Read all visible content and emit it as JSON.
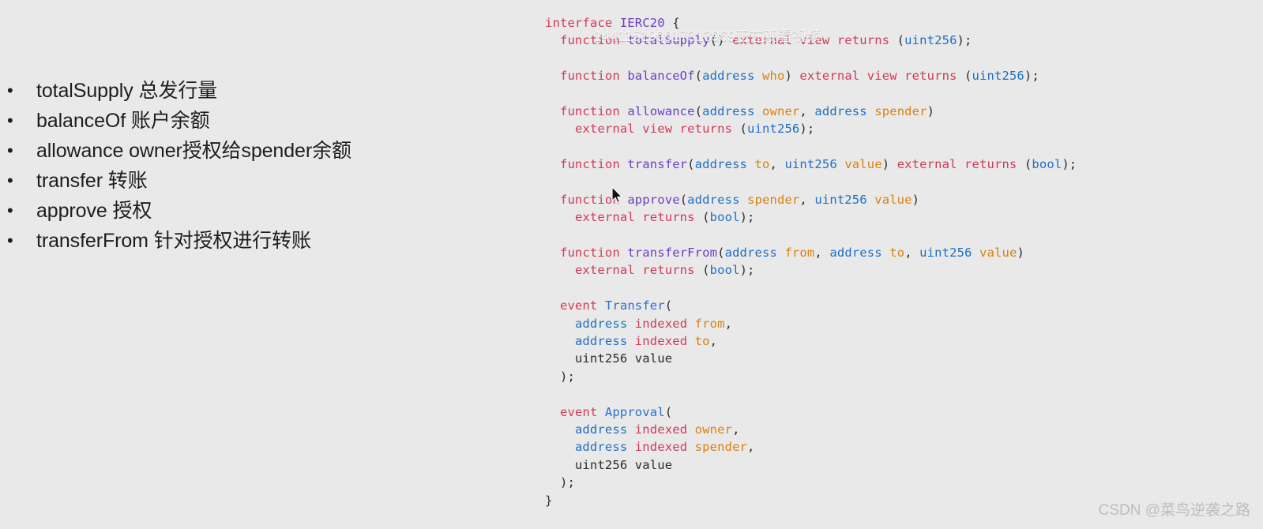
{
  "slide": {
    "background_color": "#e9e9e9",
    "bullet_glyph": "•"
  },
  "bullets": [
    {
      "text": "totalSupply 总发行量"
    },
    {
      "text": "balanceOf  账户余额"
    },
    {
      "text": "allowance owner授权给spender余额"
    },
    {
      "text": "transfer  转账"
    },
    {
      "text": "approve 授权"
    },
    {
      "text": "transferFrom 针对授权进行转账"
    }
  ],
  "code": {
    "language": "solidity",
    "colors": {
      "keyword": "#cf3a5a",
      "function_name": "#6b3fbf",
      "type": "#1f6fc4",
      "parameter": "#d9820f",
      "event_name": "#2a6fd0",
      "plain": "#2b2b2b"
    },
    "lines": [
      [
        {
          "t": "interface",
          "c": "kw"
        },
        {
          "t": " ",
          "c": "plain"
        },
        {
          "t": "IERC20",
          "c": "fn"
        },
        {
          "t": " {",
          "c": "plain"
        }
      ],
      [
        {
          "t": "  ",
          "c": "plain"
        },
        {
          "t": "function",
          "c": "kw"
        },
        {
          "t": " ",
          "c": "plain"
        },
        {
          "t": "totalSupply",
          "c": "fn"
        },
        {
          "t": "() ",
          "c": "plain"
        },
        {
          "t": "external view returns",
          "c": "kw"
        },
        {
          "t": " (",
          "c": "plain"
        },
        {
          "t": "uint256",
          "c": "type"
        },
        {
          "t": ");",
          "c": "plain"
        }
      ],
      [],
      [
        {
          "t": "  ",
          "c": "plain"
        },
        {
          "t": "function",
          "c": "kw"
        },
        {
          "t": " ",
          "c": "plain"
        },
        {
          "t": "balanceOf",
          "c": "fn"
        },
        {
          "t": "(",
          "c": "plain"
        },
        {
          "t": "address",
          "c": "type"
        },
        {
          "t": " ",
          "c": "plain"
        },
        {
          "t": "who",
          "c": "param"
        },
        {
          "t": ") ",
          "c": "plain"
        },
        {
          "t": "external view returns",
          "c": "kw"
        },
        {
          "t": " (",
          "c": "plain"
        },
        {
          "t": "uint256",
          "c": "type"
        },
        {
          "t": ");",
          "c": "plain"
        }
      ],
      [],
      [
        {
          "t": "  ",
          "c": "plain"
        },
        {
          "t": "function",
          "c": "kw"
        },
        {
          "t": " ",
          "c": "plain"
        },
        {
          "t": "allowance",
          "c": "fn"
        },
        {
          "t": "(",
          "c": "plain"
        },
        {
          "t": "address",
          "c": "type"
        },
        {
          "t": " ",
          "c": "plain"
        },
        {
          "t": "owner",
          "c": "param"
        },
        {
          "t": ", ",
          "c": "plain"
        },
        {
          "t": "address",
          "c": "type"
        },
        {
          "t": " ",
          "c": "plain"
        },
        {
          "t": "spender",
          "c": "param"
        },
        {
          "t": ")",
          "c": "plain"
        }
      ],
      [
        {
          "t": "    ",
          "c": "plain"
        },
        {
          "t": "external view returns",
          "c": "kw"
        },
        {
          "t": " (",
          "c": "plain"
        },
        {
          "t": "uint256",
          "c": "type"
        },
        {
          "t": ");",
          "c": "plain"
        }
      ],
      [],
      [
        {
          "t": "  ",
          "c": "plain"
        },
        {
          "t": "function",
          "c": "kw"
        },
        {
          "t": " ",
          "c": "plain"
        },
        {
          "t": "transfer",
          "c": "fn"
        },
        {
          "t": "(",
          "c": "plain"
        },
        {
          "t": "address",
          "c": "type"
        },
        {
          "t": " ",
          "c": "plain"
        },
        {
          "t": "to",
          "c": "param"
        },
        {
          "t": ", ",
          "c": "plain"
        },
        {
          "t": "uint256",
          "c": "type"
        },
        {
          "t": " ",
          "c": "plain"
        },
        {
          "t": "value",
          "c": "param"
        },
        {
          "t": ") ",
          "c": "plain"
        },
        {
          "t": "external returns",
          "c": "kw"
        },
        {
          "t": " (",
          "c": "plain"
        },
        {
          "t": "bool",
          "c": "type"
        },
        {
          "t": ");",
          "c": "plain"
        }
      ],
      [],
      [
        {
          "t": "  ",
          "c": "plain"
        },
        {
          "t": "function",
          "c": "kw"
        },
        {
          "t": " ",
          "c": "plain"
        },
        {
          "t": "approve",
          "c": "fn"
        },
        {
          "t": "(",
          "c": "plain"
        },
        {
          "t": "address",
          "c": "type"
        },
        {
          "t": " ",
          "c": "plain"
        },
        {
          "t": "spender",
          "c": "param"
        },
        {
          "t": ", ",
          "c": "plain"
        },
        {
          "t": "uint256",
          "c": "type"
        },
        {
          "t": " ",
          "c": "plain"
        },
        {
          "t": "value",
          "c": "param"
        },
        {
          "t": ")",
          "c": "plain"
        }
      ],
      [
        {
          "t": "    ",
          "c": "plain"
        },
        {
          "t": "external returns",
          "c": "kw"
        },
        {
          "t": " (",
          "c": "plain"
        },
        {
          "t": "bool",
          "c": "type"
        },
        {
          "t": ");",
          "c": "plain"
        }
      ],
      [],
      [
        {
          "t": "  ",
          "c": "plain"
        },
        {
          "t": "function",
          "c": "kw"
        },
        {
          "t": " ",
          "c": "plain"
        },
        {
          "t": "transferFrom",
          "c": "fn"
        },
        {
          "t": "(",
          "c": "plain"
        },
        {
          "t": "address",
          "c": "type"
        },
        {
          "t": " ",
          "c": "plain"
        },
        {
          "t": "from",
          "c": "param"
        },
        {
          "t": ", ",
          "c": "plain"
        },
        {
          "t": "address",
          "c": "type"
        },
        {
          "t": " ",
          "c": "plain"
        },
        {
          "t": "to",
          "c": "param"
        },
        {
          "t": ", ",
          "c": "plain"
        },
        {
          "t": "uint256",
          "c": "type"
        },
        {
          "t": " ",
          "c": "plain"
        },
        {
          "t": "value",
          "c": "param"
        },
        {
          "t": ")",
          "c": "plain"
        }
      ],
      [
        {
          "t": "    ",
          "c": "plain"
        },
        {
          "t": "external returns",
          "c": "kw"
        },
        {
          "t": " (",
          "c": "plain"
        },
        {
          "t": "bool",
          "c": "type"
        },
        {
          "t": ");",
          "c": "plain"
        }
      ],
      [],
      [
        {
          "t": "  ",
          "c": "plain"
        },
        {
          "t": "event",
          "c": "kw"
        },
        {
          "t": " ",
          "c": "plain"
        },
        {
          "t": "Transfer",
          "c": "evt"
        },
        {
          "t": "(",
          "c": "plain"
        }
      ],
      [
        {
          "t": "    ",
          "c": "plain"
        },
        {
          "t": "address",
          "c": "type"
        },
        {
          "t": " ",
          "c": "plain"
        },
        {
          "t": "indexed",
          "c": "kw"
        },
        {
          "t": " ",
          "c": "plain"
        },
        {
          "t": "from",
          "c": "param"
        },
        {
          "t": ",",
          "c": "plain"
        }
      ],
      [
        {
          "t": "    ",
          "c": "plain"
        },
        {
          "t": "address",
          "c": "type"
        },
        {
          "t": " ",
          "c": "plain"
        },
        {
          "t": "indexed",
          "c": "kw"
        },
        {
          "t": " ",
          "c": "plain"
        },
        {
          "t": "to",
          "c": "param"
        },
        {
          "t": ",",
          "c": "plain"
        }
      ],
      [
        {
          "t": "    uint256 value",
          "c": "plain"
        }
      ],
      [
        {
          "t": "  );",
          "c": "plain"
        }
      ],
      [],
      [
        {
          "t": "  ",
          "c": "plain"
        },
        {
          "t": "event",
          "c": "kw"
        },
        {
          "t": " ",
          "c": "plain"
        },
        {
          "t": "Approval",
          "c": "evt"
        },
        {
          "t": "(",
          "c": "plain"
        }
      ],
      [
        {
          "t": "    ",
          "c": "plain"
        },
        {
          "t": "address",
          "c": "type"
        },
        {
          "t": " ",
          "c": "plain"
        },
        {
          "t": "indexed",
          "c": "kw"
        },
        {
          "t": " ",
          "c": "plain"
        },
        {
          "t": "owner",
          "c": "param"
        },
        {
          "t": ",",
          "c": "plain"
        }
      ],
      [
        {
          "t": "    ",
          "c": "plain"
        },
        {
          "t": "address",
          "c": "type"
        },
        {
          "t": " ",
          "c": "plain"
        },
        {
          "t": "indexed",
          "c": "kw"
        },
        {
          "t": " ",
          "c": "plain"
        },
        {
          "t": "spender",
          "c": "param"
        },
        {
          "t": ",",
          "c": "plain"
        }
      ],
      [
        {
          "t": "    uint256 value",
          "c": "plain"
        }
      ],
      [
        {
          "t": "  );",
          "c": "plain"
        }
      ],
      [
        {
          "t": "}",
          "c": "plain"
        }
      ]
    ]
  },
  "watermarks": {
    "stream": "144115199917313969正在观看视频",
    "csdn": "CSDN @菜鸟逆袭之路"
  }
}
